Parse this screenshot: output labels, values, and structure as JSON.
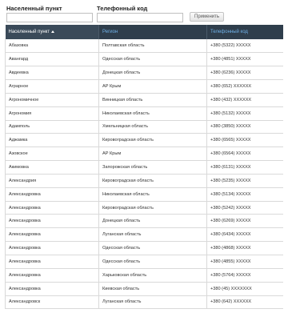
{
  "filters": {
    "locality_label": "Населенный пункт",
    "locality_value": "",
    "phone_label": "Телефонный код",
    "phone_value": "",
    "apply_label": "Применить"
  },
  "table": {
    "columns": [
      "Населенный пункт",
      "Регион",
      "Телефонный код"
    ],
    "sorted_column": "Населенный пункт",
    "sort_direction": "ascending",
    "rows": [
      [
        "Абазовка",
        "Полтавская область",
        "+380 (5322) XXXXX"
      ],
      [
        "Авангард",
        "Одесская область",
        "+380 (4851) XXXXX"
      ],
      [
        "Авдеевка",
        "Донецкая область",
        "+380 (6236) XXXXX"
      ],
      [
        "Аграрное",
        "АР Крым",
        "+380 (652) XXXXXX"
      ],
      [
        "Агрономичное",
        "Винницкая область",
        "+380 (432) XXXXXX"
      ],
      [
        "Агрономия",
        "Николаевская область",
        "+380 (5132) XXXXX"
      ],
      [
        "Адамполь",
        "Хмельницкая область",
        "+380 (3850) XXXXX"
      ],
      [
        "Аджамка",
        "Кировоградская область",
        "+380 (6565) XXXXX"
      ],
      [
        "Азовское",
        "АР Крым",
        "+380 (6564) XXXXX"
      ],
      [
        "Акимовка",
        "Запорожская область",
        "+380 (6131) XXXXX"
      ],
      [
        "Александрия",
        "Кировоградская область",
        "+380 (5235) XXXXX"
      ],
      [
        "Александровка",
        "Николаевская область",
        "+380 (5134) XXXXX"
      ],
      [
        "Александровка",
        "Кировоградская область",
        "+380 (5242) XXXXX"
      ],
      [
        "Александровка",
        "Донецкая область",
        "+380 (6269) XXXXX"
      ],
      [
        "Александровка",
        "Луганская область",
        "+380 (6434) XXXXX"
      ],
      [
        "Александровка",
        "Одесская область",
        "+380 (4868) XXXXX"
      ],
      [
        "Александровка",
        "Одесская область",
        "+380 (4855) XXXXX"
      ],
      [
        "Александровка",
        "Харьковская область",
        "+380 (5764) XXXXX"
      ],
      [
        "Александровка",
        "Киевская область",
        "+380 (45) XXXXXXX"
      ],
      [
        "Александровск",
        "Луганская область",
        "+380 (642) XXXXXX"
      ]
    ]
  }
}
